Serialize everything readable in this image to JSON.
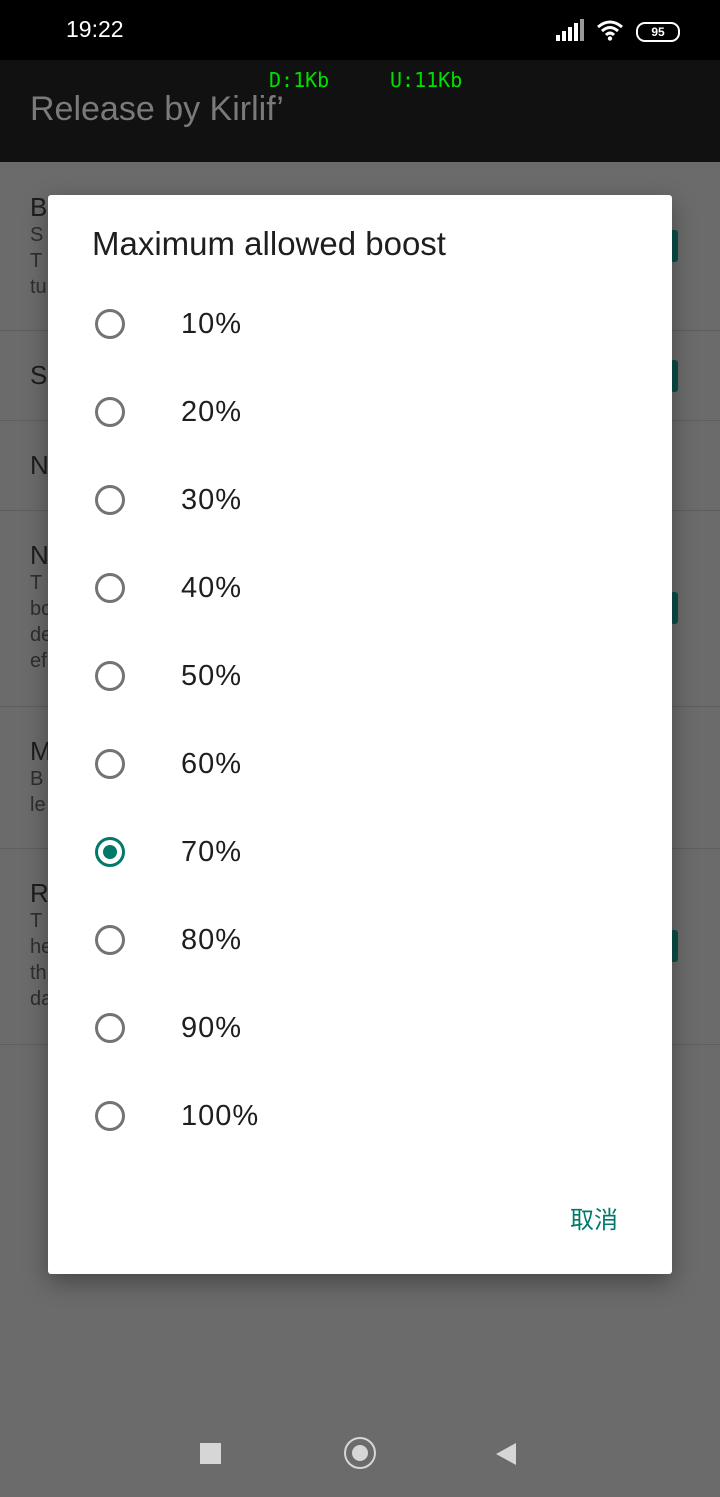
{
  "status_bar": {
    "time": "19:22",
    "battery": "95"
  },
  "app_bar": {
    "title": "Release by Kirlif’",
    "download_speed": "D:1Kb",
    "upload_speed": "U:11Kb"
  },
  "background_rows": [
    {
      "title": "B",
      "lines": [
        "S",
        "T",
        "tu"
      ]
    },
    {
      "title": "S",
      "lines": []
    },
    {
      "title": "N",
      "lines": []
    },
    {
      "title": "N",
      "lines": [
        "T",
        "bo",
        "de",
        "ef"
      ]
    },
    {
      "title": "M",
      "lines": [
        "B",
        "le"
      ]
    },
    {
      "title": "R",
      "lines": [
        "T",
        "he",
        "th",
        "da"
      ]
    }
  ],
  "dialog": {
    "title": "Maximum allowed boost",
    "options": [
      {
        "label": "10%",
        "checked": false
      },
      {
        "label": "20%",
        "checked": false
      },
      {
        "label": "30%",
        "checked": false
      },
      {
        "label": "40%",
        "checked": false
      },
      {
        "label": "50%",
        "checked": false
      },
      {
        "label": "60%",
        "checked": false
      },
      {
        "label": "70%",
        "checked": true
      },
      {
        "label": "80%",
        "checked": false
      },
      {
        "label": "90%",
        "checked": false
      },
      {
        "label": "100%",
        "checked": false
      }
    ],
    "cancel_label": "取消"
  },
  "colors": {
    "accent": "#00796b",
    "appbar": "#111111",
    "netspeed": "#00e000"
  },
  "icons": {
    "nav": [
      "recent-apps-icon",
      "home-icon",
      "back-icon"
    ],
    "status": [
      "signal-icon",
      "wifi-icon",
      "battery-icon"
    ]
  }
}
